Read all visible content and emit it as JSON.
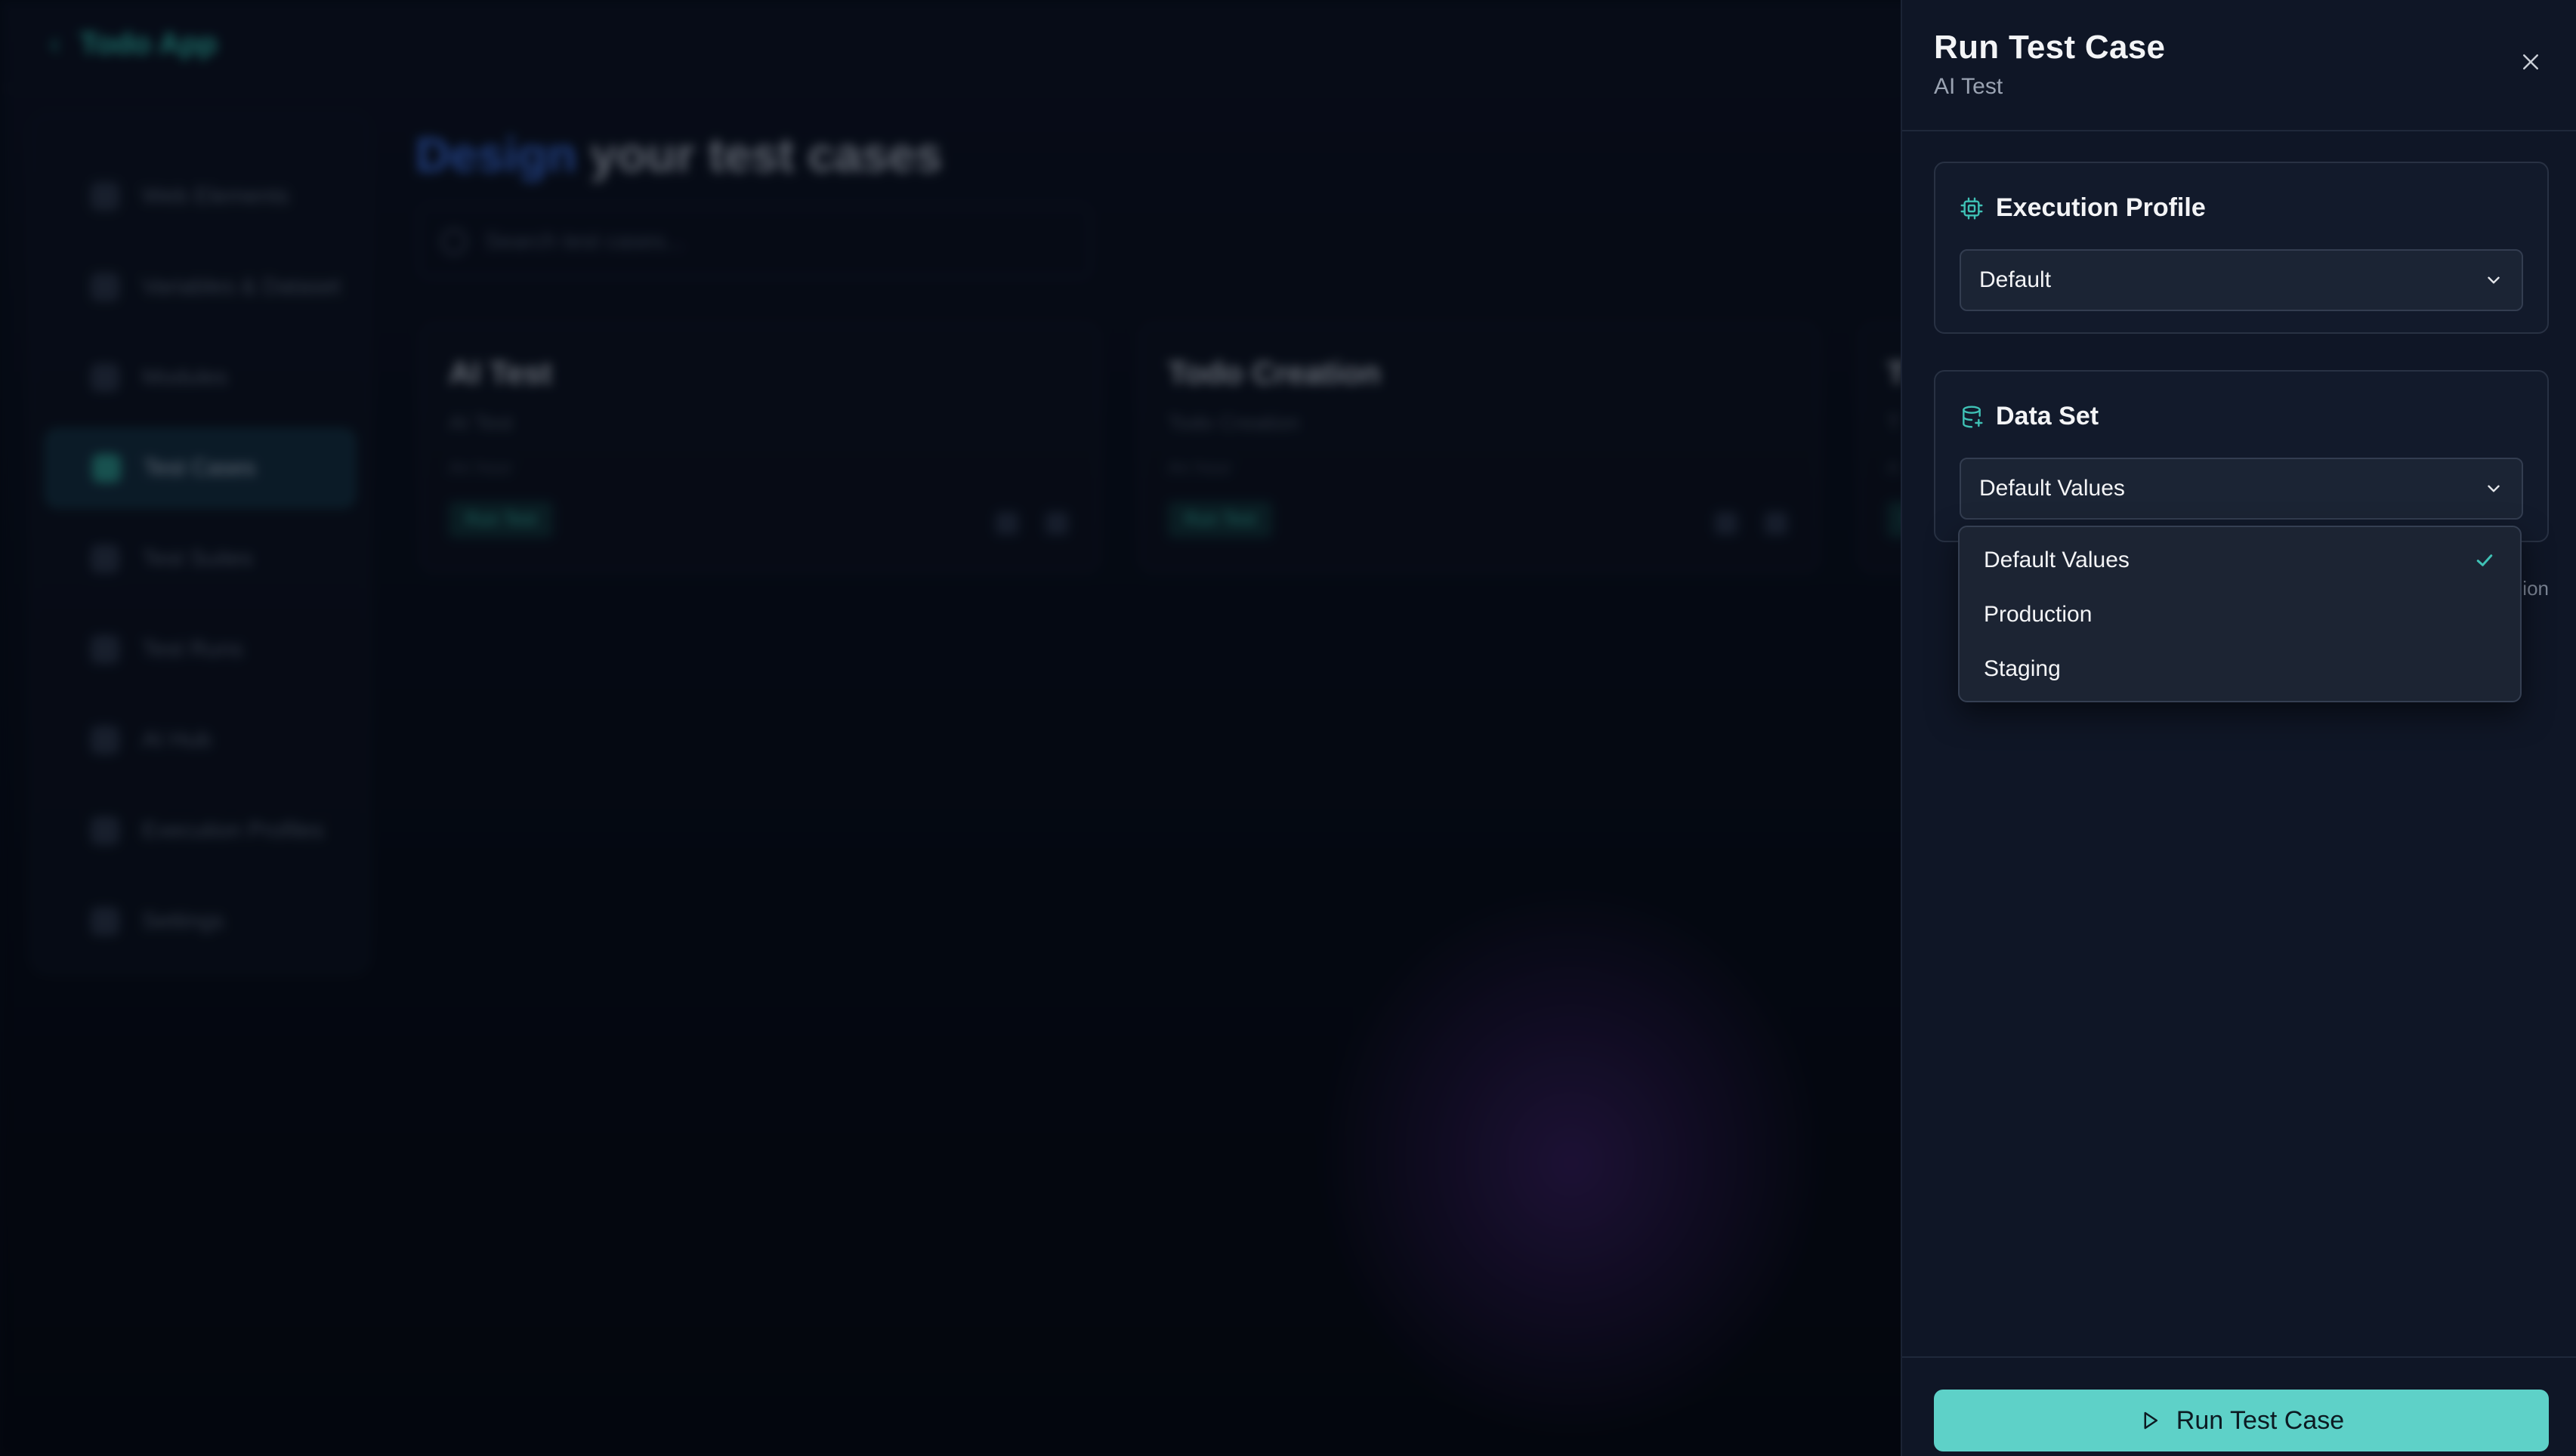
{
  "background": {
    "brand": "Todo App",
    "sidebar": [
      {
        "label": "Web Elements"
      },
      {
        "label": "Variables & Dataset"
      },
      {
        "label": "Modules"
      },
      {
        "label": "Test Cases"
      },
      {
        "label": "Test Suites"
      },
      {
        "label": "Test Runs"
      },
      {
        "label": "AI Hub"
      },
      {
        "label": "Execution Profiles"
      },
      {
        "label": "Settings"
      }
    ],
    "title_accent": "Design",
    "title_rest": " your test cases",
    "search_placeholder": "Search test cases...",
    "cards": [
      {
        "title": "AI Test",
        "subtitle": "AI Test",
        "meta": "An hour",
        "badge": "Run Test"
      },
      {
        "title": "Todo Creation",
        "subtitle": "Todo Creation",
        "meta": "An hour",
        "badge": "Run Test"
      },
      {
        "title": "T",
        "subtitle": "T",
        "meta": "A",
        "badge": "R"
      }
    ]
  },
  "panel": {
    "title": "Run Test Case",
    "subtitle": "AI Test",
    "execution_profile": {
      "label": "Execution Profile",
      "selected": "Default"
    },
    "data_set": {
      "label": "Data Set",
      "selected": "Default Values",
      "options": [
        "Default Values",
        "Production",
        "Staging"
      ]
    },
    "obscured_text": "ion",
    "run_button": "Run Test Case"
  },
  "colors": {
    "accent": "#5ed1c8",
    "icon_accent": "#3fc1b5",
    "panel_bg": "#0f1626"
  }
}
